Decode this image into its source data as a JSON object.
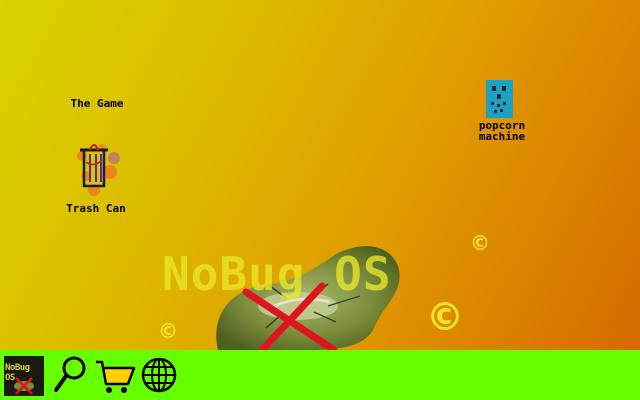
{
  "desktop": {
    "icons": [
      {
        "label": "The Game",
        "icon": "game-icon"
      },
      {
        "label": "Trash Can",
        "icon": "trash-can-icon"
      },
      {
        "label": "popcorn\nmachine",
        "icon": "popcorn-machine-icon"
      }
    ],
    "wallpaper": {
      "logo_text": "NoBug OS",
      "copyright_symbol": "©",
      "colors": {
        "top_left": "#d8d400",
        "bottom_right": "#d66a00",
        "logo": "#e8e828"
      }
    }
  },
  "taskbar": {
    "background": "#66ff00",
    "start_button": {
      "label": "NoBug OS",
      "icon": "nobug-os-start-icon"
    },
    "buttons": [
      {
        "icon": "magnifier-search-icon"
      },
      {
        "icon": "shopping-cart-icon"
      },
      {
        "icon": "globe-icon"
      }
    ]
  }
}
